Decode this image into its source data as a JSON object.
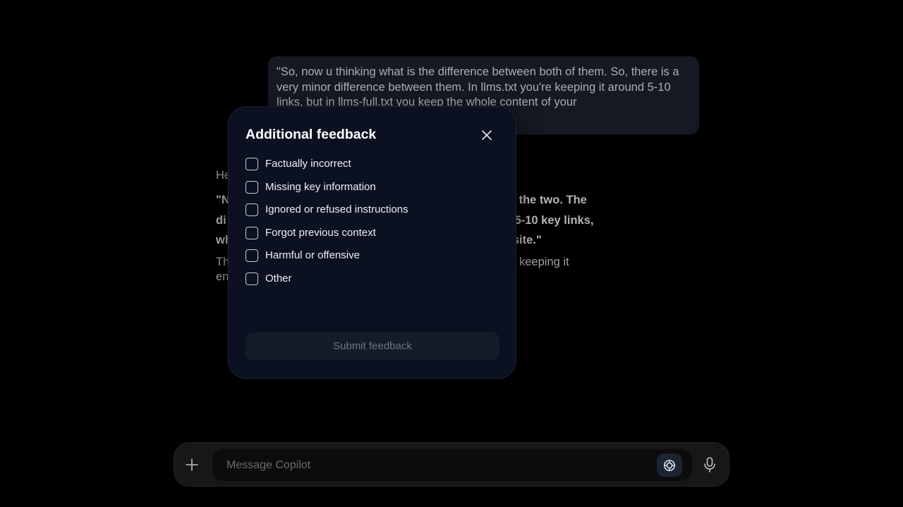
{
  "chat": {
    "user_message": "\"So, now u thinking what is the difference between both of them. So, there is a very minor difference between them. In llms.txt you're keeping it around 5-10 links, but in llms-full.txt you keep the whole content of your",
    "assistant": {
      "intro": "He                                                                       tence:",
      "quote_line1": "\"N                                                                       e between the two. The",
      "quote_line2": "di                                                                       es around 5-10 key links,",
      "quote_line3": "wh                                                                       your website.\"",
      "outro_line1": "Th                                                                       alism while keeping it",
      "outro_line2": "en                                                                       s!"
    }
  },
  "modal": {
    "title": "Additional feedback",
    "close_icon": "close-icon",
    "options": [
      {
        "label": "Factually incorrect",
        "checked": false
      },
      {
        "label": "Missing key information",
        "checked": false
      },
      {
        "label": "Ignored or refused instructions",
        "checked": false
      },
      {
        "label": "Forgot previous context",
        "checked": false
      },
      {
        "label": "Harmful or offensive",
        "checked": false
      },
      {
        "label": "Other",
        "checked": false
      }
    ],
    "submit_label": "Submit feedback"
  },
  "composer": {
    "placeholder": "Message Copilot",
    "plus_icon": "plus-icon",
    "smart_icon": "copilot-mode-icon",
    "mic_icon": "microphone-icon"
  },
  "colors": {
    "background": "#000000",
    "modal_bg": "#0b1120",
    "bubble_bg": "#151923",
    "composer_bg": "#171717"
  }
}
